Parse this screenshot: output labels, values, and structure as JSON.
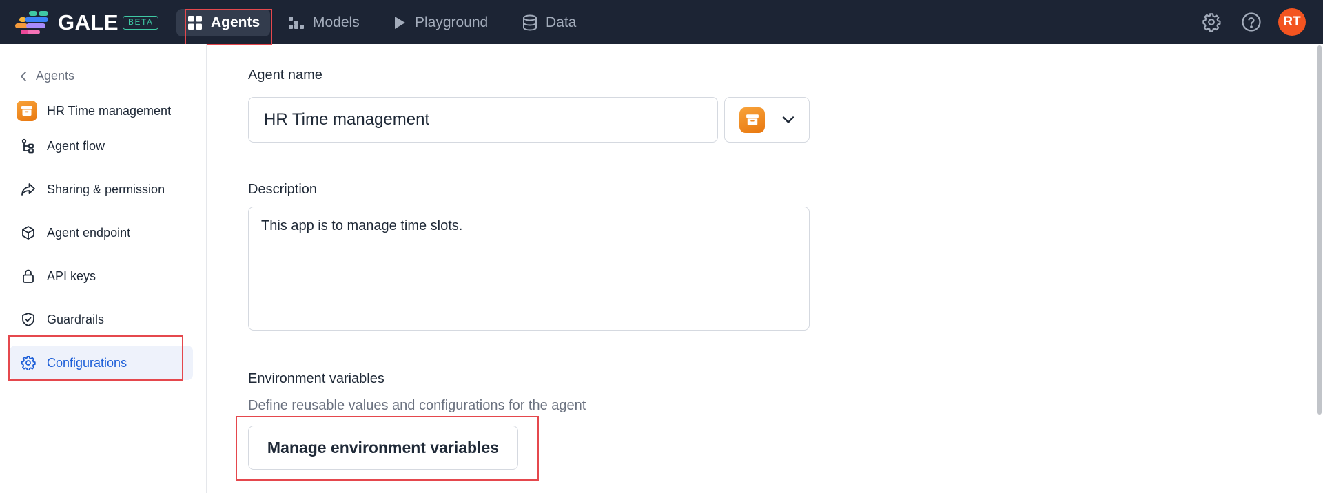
{
  "app": {
    "brand": "GALE",
    "badge": "BETA"
  },
  "topnav": {
    "items": [
      {
        "label": "Agents",
        "icon": "grid-icon",
        "active": true
      },
      {
        "label": "Models",
        "icon": "models-icon"
      },
      {
        "label": "Playground",
        "icon": "play-icon"
      },
      {
        "label": "Data",
        "icon": "database-icon"
      }
    ],
    "user_initials": "RT"
  },
  "sidebar": {
    "back_label": "Agents",
    "agent_name": "HR Time management",
    "items": [
      {
        "label": "Agent flow",
        "icon": "flow-icon"
      },
      {
        "label": "Sharing & permission",
        "icon": "share-icon"
      },
      {
        "label": "Agent endpoint",
        "icon": "cube-icon"
      },
      {
        "label": "API keys",
        "icon": "lock-icon"
      },
      {
        "label": "Guardrails",
        "icon": "shield-icon"
      },
      {
        "label": "Configurations",
        "icon": "gear-icon",
        "active": true
      }
    ]
  },
  "form": {
    "agent_name_label": "Agent name",
    "agent_name_value": "HR Time management",
    "description_label": "Description",
    "description_value": "This app is to manage time slots.",
    "env_label": "Environment variables",
    "env_help": "Define reusable values and configurations for the agent",
    "manage_button": "Manage environment variables"
  },
  "colors": {
    "topbar": "#1c2434",
    "accent": "#1d5fd8",
    "avatar": "#f35420",
    "agent_icon": "#f08a24",
    "highlight": "#e5484d"
  }
}
